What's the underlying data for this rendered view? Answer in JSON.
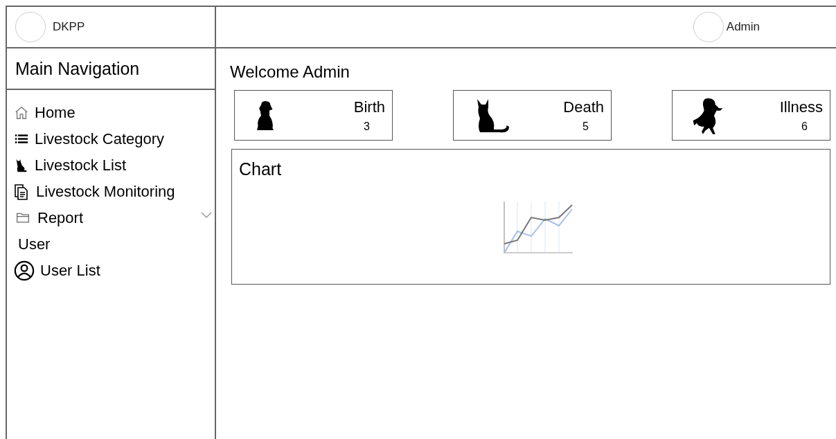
{
  "brand": {
    "name": "DKPP"
  },
  "user": {
    "name": "Admin"
  },
  "sidebar": {
    "title": "Main Navigation",
    "items": [
      {
        "label": "Home",
        "kind": "link"
      },
      {
        "label": "Livestock Category",
        "kind": "link"
      },
      {
        "label": "Livestock List",
        "kind": "link"
      },
      {
        "label": "Livestock Monitoring",
        "kind": "link"
      },
      {
        "label": "Report",
        "kind": "submenu",
        "expanded": false
      },
      {
        "label": "User",
        "kind": "section"
      },
      {
        "label": "User List",
        "kind": "link"
      }
    ]
  },
  "main": {
    "title": "Welcome Admin",
    "stats": [
      {
        "label": "Birth",
        "count": "3"
      },
      {
        "label": "Death",
        "count": "5"
      },
      {
        "label": "Illness",
        "count": "6"
      }
    ],
    "chart": {
      "title": "Chart"
    }
  }
}
